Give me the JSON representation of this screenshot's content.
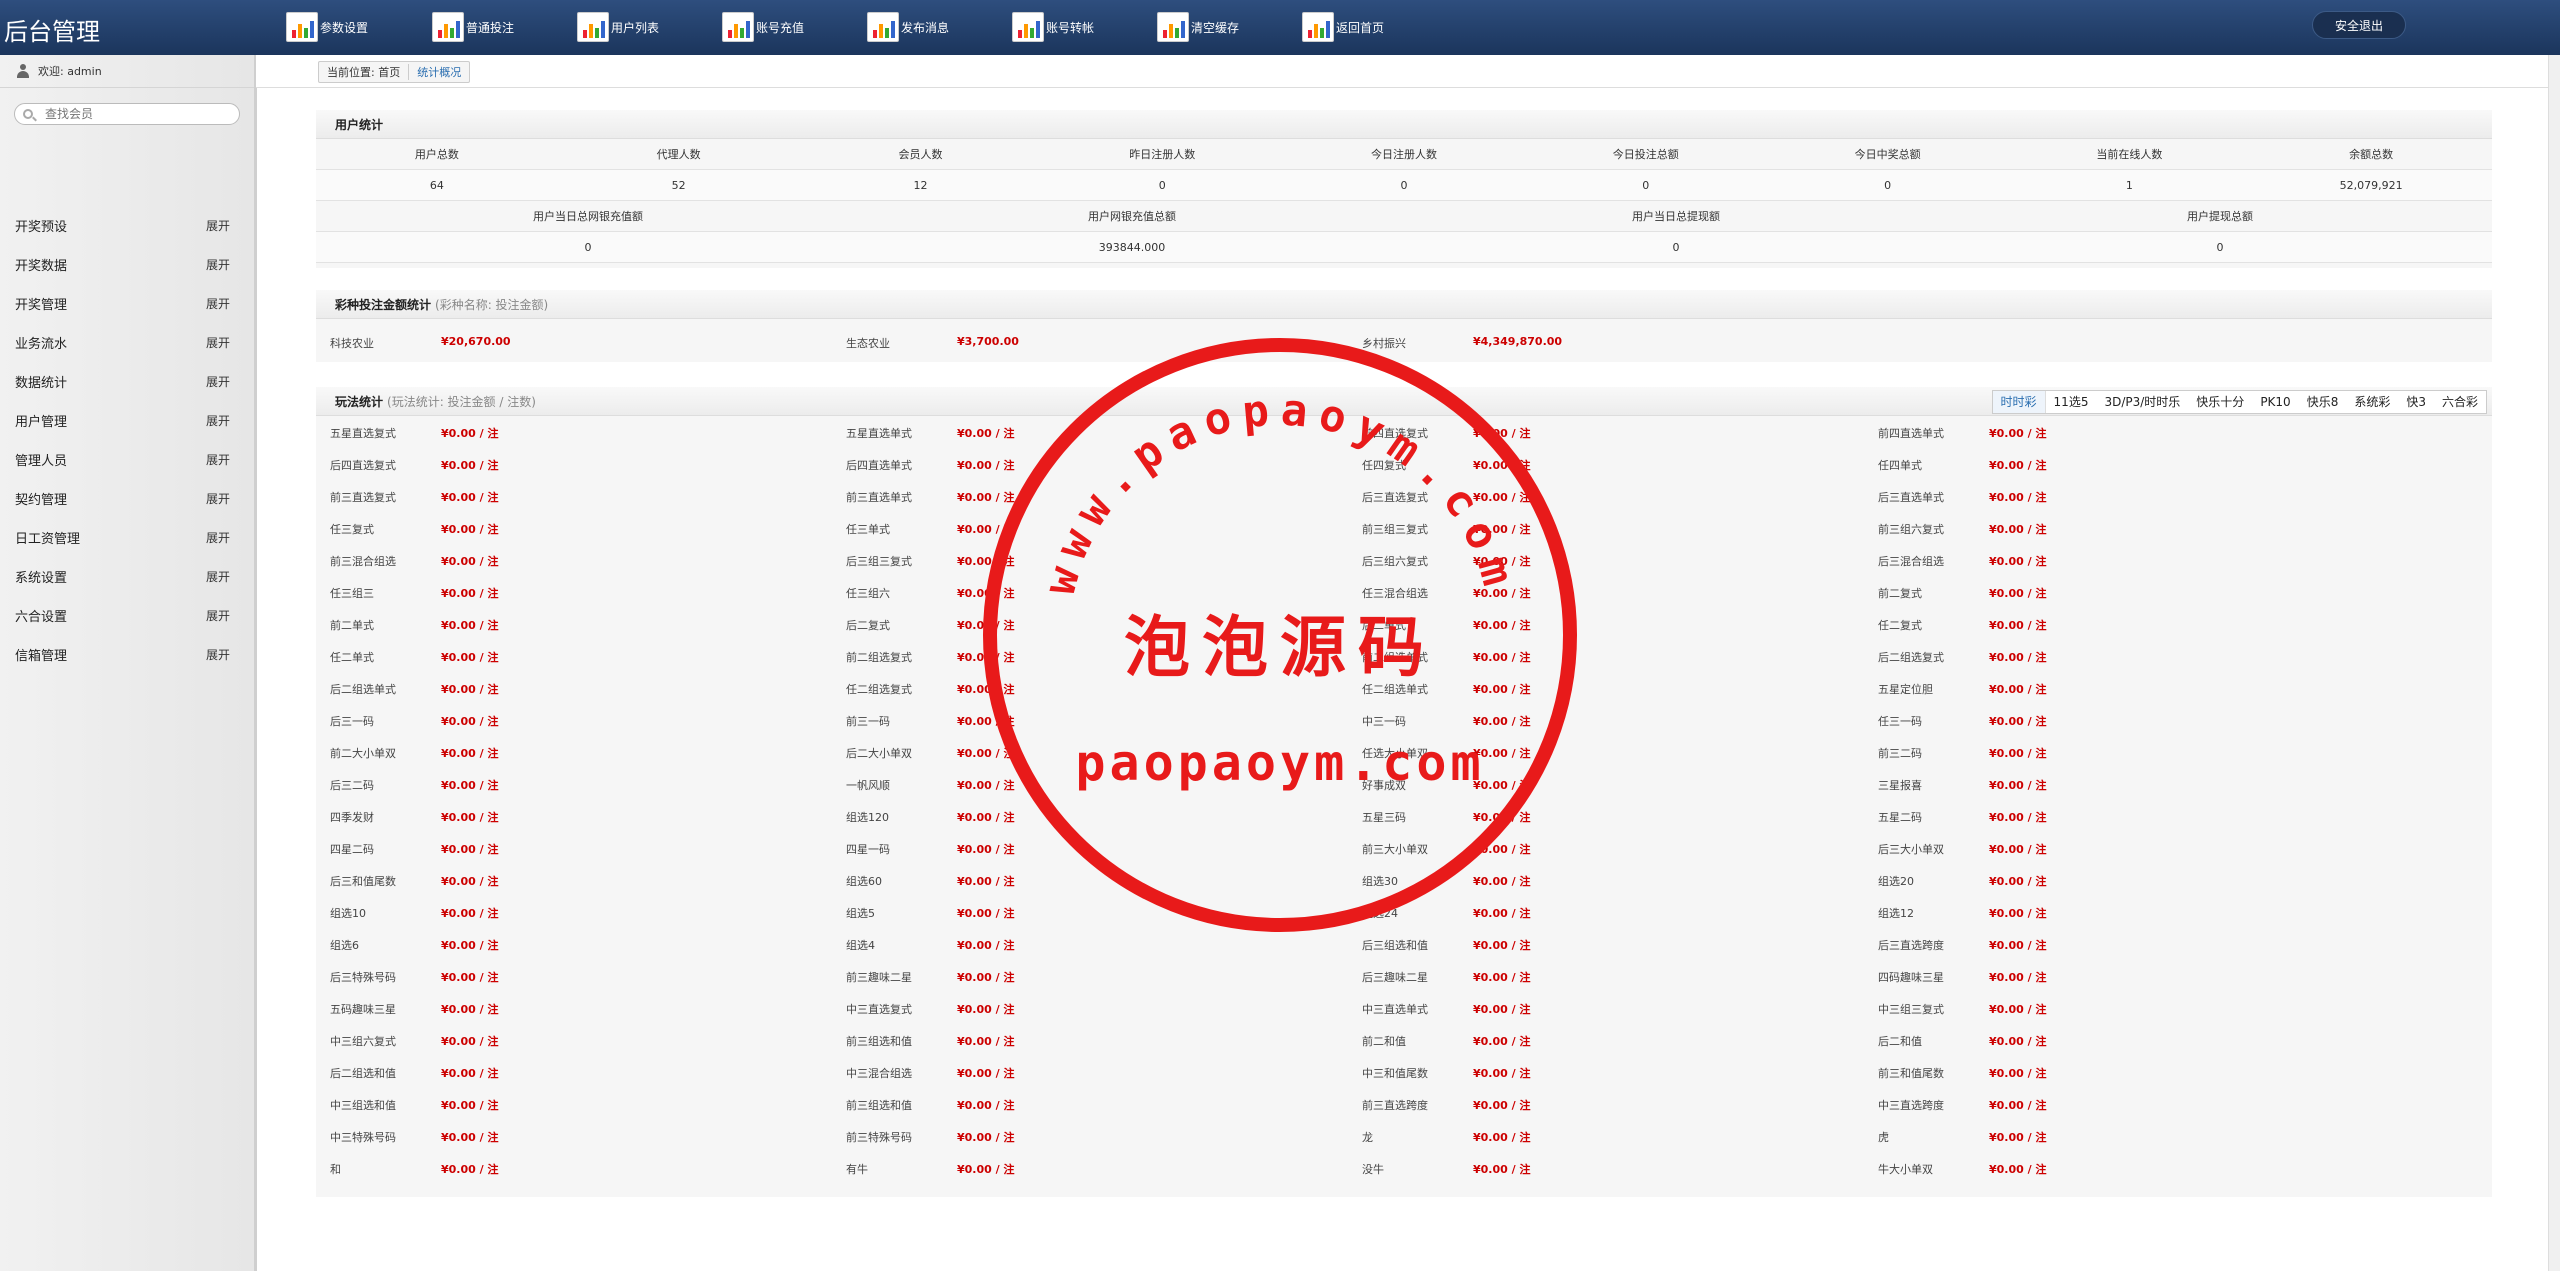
{
  "app_title": "后台管理",
  "topnav": [
    {
      "label": "参数设置"
    },
    {
      "label": "普通投注"
    },
    {
      "label": "用户列表"
    },
    {
      "label": "账号充值"
    },
    {
      "label": "发布消息"
    },
    {
      "label": "账号转帐"
    },
    {
      "label": "清空缓存"
    },
    {
      "label": "返回首页"
    }
  ],
  "logout_label": "安全退出",
  "sidebar": {
    "welcome": "欢迎: admin",
    "search_placeholder": "查找会员",
    "expand_label": "展开",
    "items": [
      "开奖预设",
      "开奖数据",
      "开奖管理",
      "业务流水",
      "数据统计",
      "用户管理",
      "管理人员",
      "契约管理",
      "日工资管理",
      "系统设置",
      "六合设置",
      "信箱管理"
    ]
  },
  "breadcrumb": {
    "prefix": "当前位置: 首页",
    "current": "统计概况"
  },
  "user_stats": {
    "title": "用户统计",
    "headers1": [
      "用户总数",
      "代理人数",
      "会员人数",
      "昨日注册人数",
      "今日注册人数",
      "今日投注总额",
      "今日中奖总额",
      "当前在线人数",
      "余额总数"
    ],
    "values1": [
      "64",
      "52",
      "12",
      "0",
      "0",
      "0",
      "0",
      "1",
      "52,079,921"
    ],
    "headers2": [
      "用户当日总网银充值额",
      "用户网银充值总额",
      "用户当日总提现额",
      "用户提现总额"
    ],
    "values2": [
      "0",
      "393844.000",
      "0",
      "0"
    ]
  },
  "lottery_stats": {
    "title": "彩种投注金额统计",
    "subtitle": "(彩种名称: 投注金额)",
    "items": [
      {
        "name": "科技农业",
        "value": "¥20,670.00"
      },
      {
        "name": "生态农业",
        "value": "¥3,700.00"
      },
      {
        "name": "乡村振兴",
        "value": "¥4,349,870.00"
      }
    ]
  },
  "play_stats": {
    "title": "玩法统计",
    "subtitle": "(玩法统计: 投注金额 / 注数)",
    "value": "¥0.00 / 注",
    "tabs": [
      "时时彩",
      "11选5",
      "3D/P3/时时乐",
      "快乐十分",
      "PK10",
      "快乐8",
      "系统彩",
      "快3",
      "六合彩"
    ],
    "rows": [
      [
        "五星直选复式",
        "五星直选单式",
        "前四直选复式",
        "前四直选单式"
      ],
      [
        "后四直选复式",
        "后四直选单式",
        "任四复式",
        "任四单式"
      ],
      [
        "前三直选复式",
        "前三直选单式",
        "后三直选复式",
        "后三直选单式"
      ],
      [
        "任三复式",
        "任三单式",
        "前三组三复式",
        "前三组六复式"
      ],
      [
        "前三混合组选",
        "后三组三复式",
        "后三组六复式",
        "后三混合组选"
      ],
      [
        "任三组三",
        "任三组六",
        "任三混合组选",
        "前二复式"
      ],
      [
        "前二单式",
        "后二复式",
        "后二单式",
        "任二复式"
      ],
      [
        "任二单式",
        "前二组选复式",
        "前二组选单式",
        "后二组选复式"
      ],
      [
        "后二组选单式",
        "任二组选复式",
        "任二组选单式",
        "五星定位胆"
      ],
      [
        "后三一码",
        "前三一码",
        "中三一码",
        "任三一码"
      ],
      [
        "前二大小单双",
        "后二大小单双",
        "任选大小单双",
        "前三二码"
      ],
      [
        "后三二码",
        "一帆风顺",
        "好事成双",
        "三星报喜"
      ],
      [
        "四季发财",
        "组选120",
        "五星三码",
        "五星二码"
      ],
      [
        "四星二码",
        "四星一码",
        "前三大小单双",
        "后三大小单双"
      ],
      [
        "后三和值尾数",
        "组选60",
        "组选30",
        "组选20"
      ],
      [
        "组选10",
        "组选5",
        "组选24",
        "组选12"
      ],
      [
        "组选6",
        "组选4",
        "后三组选和值",
        "后三直选跨度"
      ],
      [
        "后三特殊号码",
        "前三趣味二星",
        "后三趣味二星",
        "四码趣味三星"
      ],
      [
        "五码趣味三星",
        "中三直选复式",
        "中三直选单式",
        "中三组三复式"
      ],
      [
        "中三组六复式",
        "前三组选和值",
        "前二和值",
        "后二和值"
      ],
      [
        "后二组选和值",
        "中三混合组选",
        "中三和值尾数",
        "前三和值尾数"
      ],
      [
        "中三组选和值",
        "前三组选和值",
        "前三直选跨度",
        "中三直选跨度"
      ],
      [
        "中三特殊号码",
        "前三特殊号码",
        "龙",
        "虎"
      ],
      [
        "和",
        "有牛",
        "没牛",
        "牛大小单双"
      ]
    ]
  },
  "watermark": {
    "line_top": "paopaoym.com",
    "line_www": "www.",
    "cn": "泡泡源码",
    "line_bottom": "paopaoym.com"
  },
  "colors": {
    "accent": "#2a6eb0",
    "money": "#cc0000",
    "topbar": "#1b355c",
    "stamp": "#e81a1a"
  }
}
